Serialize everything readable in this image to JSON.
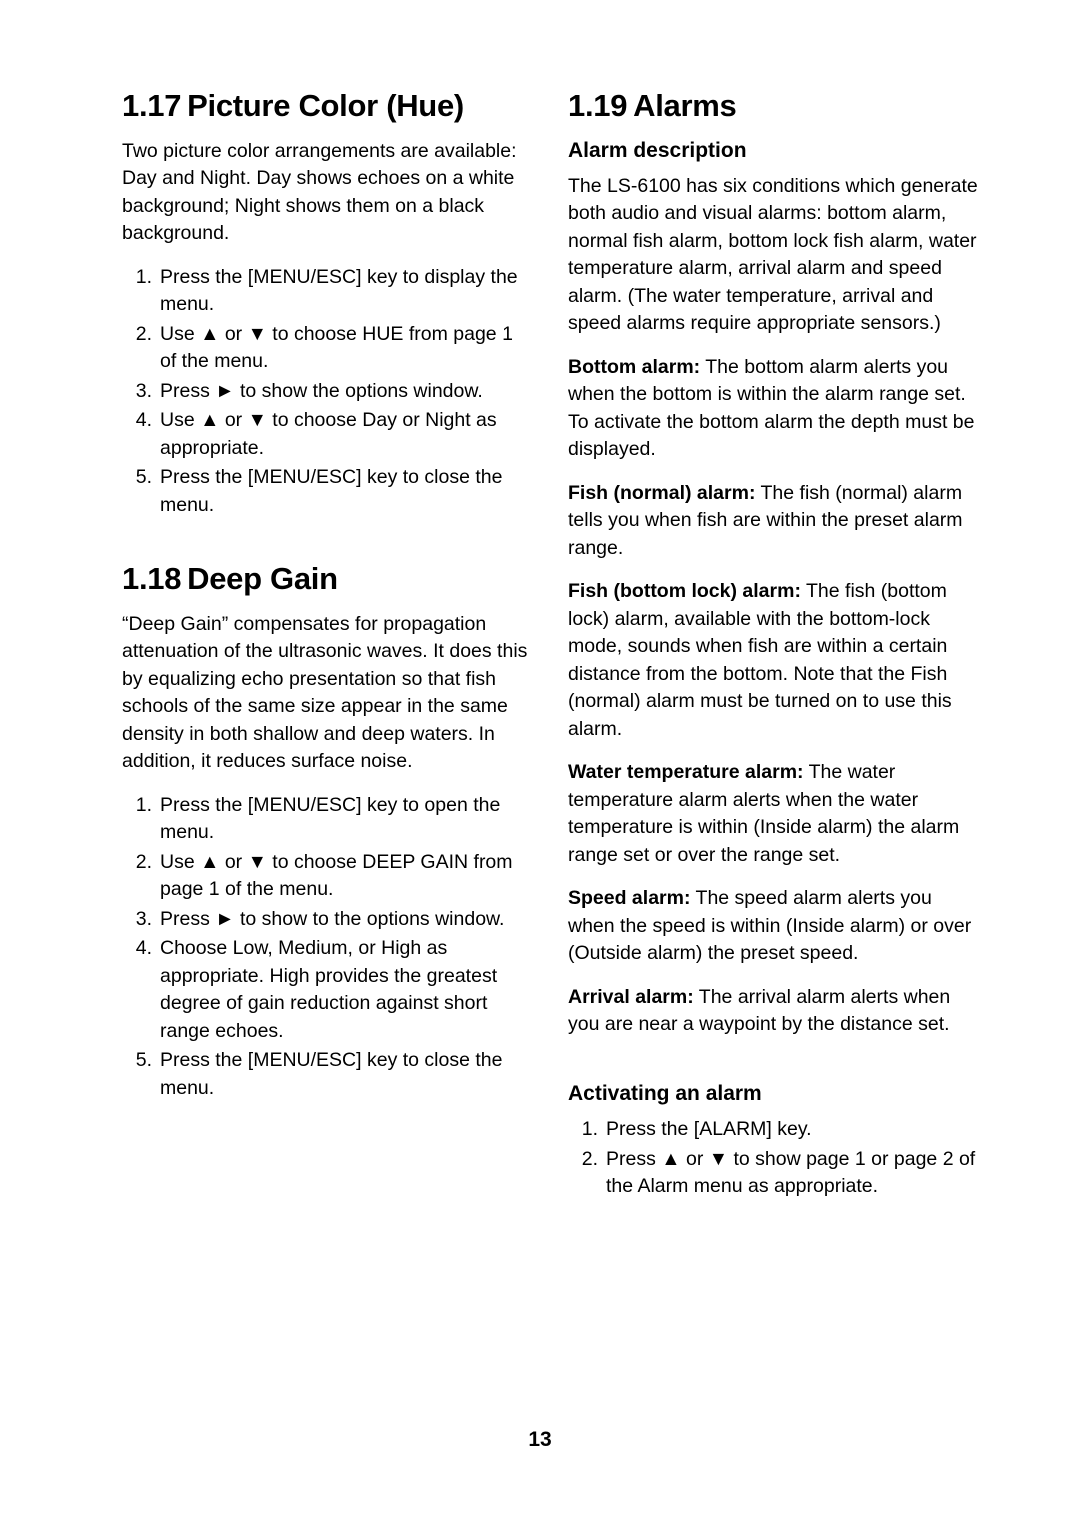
{
  "document": {
    "page_number": "13",
    "left_column": {
      "section_1": {
        "number": "1.17",
        "title": "Picture Color (Hue)",
        "intro": "Two picture color arrangements are available: Day and Night. Day shows echoes on a white background; Night shows them on a black background.",
        "steps": [
          {
            "marker": "1.",
            "text": "Press the [MENU/ESC] key to display the menu."
          },
          {
            "marker": "2.",
            "text": "Use ▲ or ▼ to choose HUE from page 1 of the menu."
          },
          {
            "marker": "3.",
            "text": "Press ► to show the options window."
          },
          {
            "marker": "4.",
            "text": "Use ▲ or ▼ to choose Day or Night as appropriate."
          },
          {
            "marker": "5.",
            "text": "Press the [MENU/ESC] key to close the menu."
          }
        ]
      },
      "section_2": {
        "number": "1.18",
        "title": "Deep Gain",
        "intro": "“Deep Gain” compensates for propagation attenuation of the ultrasonic waves. It does this by equalizing echo presentation so that fish schools of the same size appear in the same density in both shallow and deep waters. In addition, it reduces surface noise.",
        "steps": [
          {
            "marker": "1.",
            "text": "Press the [MENU/ESC] key to open the menu."
          },
          {
            "marker": "2.",
            "text": "Use ▲ or ▼ to choose DEEP GAIN from page 1 of the menu."
          },
          {
            "marker": "3.",
            "text": "Press ► to show to the options window."
          },
          {
            "marker": "4.",
            "text": "Choose Low, Medium, or High as appropriate. High provides the greatest degree of gain reduction against short range echoes."
          },
          {
            "marker": "5.",
            "text": "Press the [MENU/ESC] key to close the menu."
          }
        ]
      }
    },
    "right_column": {
      "section_3": {
        "number": "1.19",
        "title": "Alarms",
        "subhead_1": "Alarm description",
        "intro": "The LS-6100 has six conditions which generate both audio and visual alarms: bottom alarm, normal fish alarm, bottom lock fish alarm, water temperature alarm, arrival alarm and speed alarm. (The water temperature, arrival and speed alarms require appropriate sensors.)",
        "alarms": [
          {
            "lead": "Bottom alarm:",
            "text": " The bottom alarm alerts you when the bottom is within the alarm range set. To activate the bottom alarm the depth must be displayed."
          },
          {
            "lead": "Fish (normal) alarm:",
            "text": " The fish (normal) alarm tells you when fish are within the preset alarm range."
          },
          {
            "lead": "Fish (bottom lock) alarm:",
            "text": " The fish (bottom lock) alarm, available with the bottom-lock mode, sounds when fish are within a certain distance from the bottom. Note that the Fish (normal) alarm must be turned on to use this alarm."
          },
          {
            "lead": "Water temperature alarm:",
            "text": " The water temperature alarm alerts when the water temperature is within (Inside alarm) the alarm range set or over the range set."
          },
          {
            "lead": "Speed alarm:",
            "text": " The speed alarm alerts you when the speed is within (Inside alarm) or over (Outside alarm) the preset speed."
          },
          {
            "lead": "Arrival alarm:",
            "text": " The arrival alarm alerts when you are near a waypoint by the distance set."
          }
        ],
        "subhead_2": "Activating an alarm",
        "steps": [
          {
            "marker": "1.",
            "text": "Press the [ALARM] key."
          },
          {
            "marker": "2.",
            "text": "Press ▲ or ▼ to show page 1 or page 2 of the Alarm menu as appropriate."
          }
        ]
      }
    }
  }
}
